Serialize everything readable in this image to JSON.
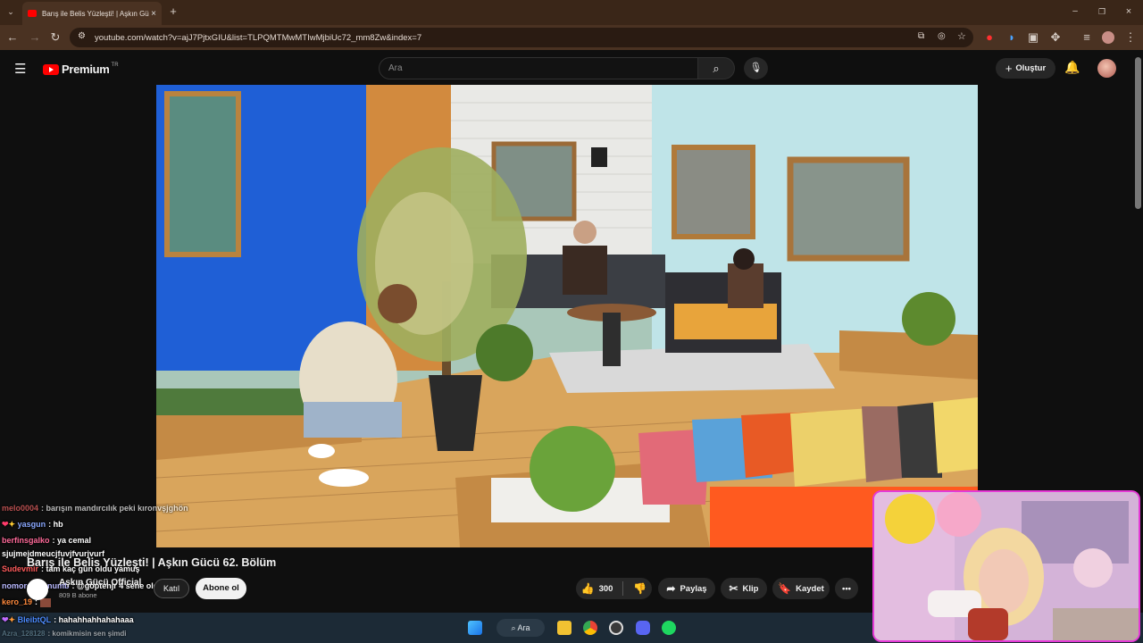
{
  "browser": {
    "tab_title": "Barış ile Belis Yüzleşti! | Aşkın Gü",
    "url": "youtube.com/watch?v=ajJ7PjtxGIU&list=TLPQMTMwMTIwMjbiUc72_mm8Zw&index=7"
  },
  "youtube": {
    "logo_text": "Premium",
    "country_code": "TR",
    "search_placeholder": "Ara",
    "create_label": "Oluştur"
  },
  "video": {
    "title": "Barış ile Belis Yüzleşti! | Aşkın Gücü 62. Bölüm",
    "channel": "Aşkın Gücü Official",
    "subscribers": "809 B abone",
    "join_label": "Katıl",
    "subscribe_label": "Abone ol",
    "likes": "300",
    "share_label": "Paylaş",
    "clip_label": "Klip",
    "save_label": "Kaydet"
  },
  "chat": [
    {
      "user": "melo0004",
      "message": ": barışın mandırcılık peki kıronvşjghön",
      "color": "#ff6b6b"
    },
    {
      "user": "yasgun",
      "message": ": hb",
      "color": "#8aa8ff"
    },
    {
      "user": "berfinsgalko",
      "message": ": ya cemal",
      "color": "#ff6b9a"
    },
    {
      "user": "sjujmejdmeucjfuvjfvurjvurf",
      "message": "",
      "color": "#ffffff"
    },
    {
      "user": "Sudevmir",
      "message": ": tam kaç gün oldu yamuş",
      "color": "#ff5c5c"
    },
    {
      "user": "nomoremeanumb",
      "message": ": @goptenjr 4 sene oldu",
      "color": "#b9b9ff"
    },
    {
      "user": "kero_19",
      "message": ":",
      "color": "#ff8a3d"
    },
    {
      "user": "BleibtQL",
      "message": ": hahahhahhahahaaa",
      "color": "#4d8cff"
    },
    {
      "user": "Azra_128128",
      "message": ": komikmisin sen şimdi",
      "color": "#7aa0b0"
    }
  ],
  "taskbar": {
    "search_label": "Ara"
  }
}
